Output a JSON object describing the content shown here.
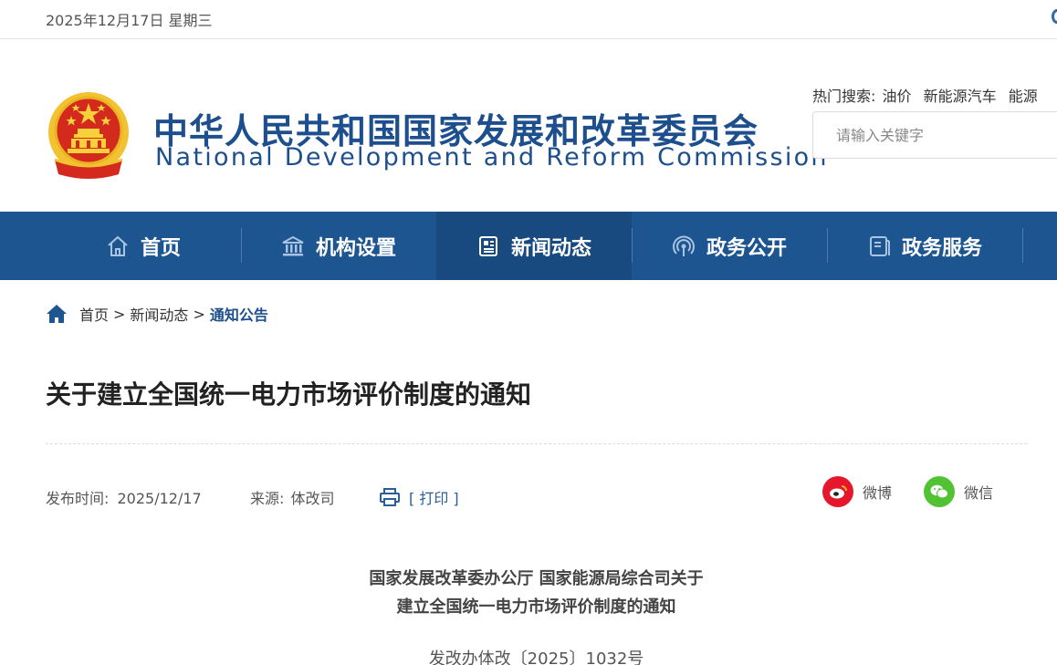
{
  "topbar": {
    "date": "2025年12月17日 星期三"
  },
  "header": {
    "title_cn": "中华人民共和国国家发展和改革委员会",
    "title_en": "National Development and Reform Commission",
    "hot_label": "热门搜索:",
    "hot_items": [
      "油价",
      "新能源汽车",
      "能源"
    ],
    "search_placeholder": "请输入关键字"
  },
  "nav": {
    "items": [
      {
        "label": "首页",
        "icon": "home-outline-icon"
      },
      {
        "label": "机构设置",
        "icon": "institution-icon"
      },
      {
        "label": "新闻动态",
        "icon": "news-icon",
        "active": true
      },
      {
        "label": "政务公开",
        "icon": "broadcast-icon"
      },
      {
        "label": "政务服务",
        "icon": "document-icon"
      }
    ]
  },
  "breadcrumb": {
    "home": "首页",
    "separator": ">",
    "section": "新闻动态",
    "current": "通知公告"
  },
  "article": {
    "title": "关于建立全国统一电力市场评价制度的通知",
    "publish_label": "发布时间:",
    "publish_date": "2025/12/17",
    "source_label": "来源:",
    "source": "体改司",
    "print_label": "[ 打印 ]",
    "share": [
      {
        "label": "微博",
        "icon": "weibo-icon",
        "color": "#e6162d"
      },
      {
        "label": "微信",
        "icon": "wechat-icon",
        "color": "#51c332"
      }
    ],
    "doc_heading_line1": "国家发展改革委办公厅 国家能源局综合司关于",
    "doc_heading_line2": "建立全国统一电力市场评价制度的通知",
    "doc_number": "发改办体改〔2025〕1032号"
  },
  "colors": {
    "brand_blue": "#1d4f8e",
    "nav_bg": "#1d5591",
    "nav_active": "#184a80"
  }
}
